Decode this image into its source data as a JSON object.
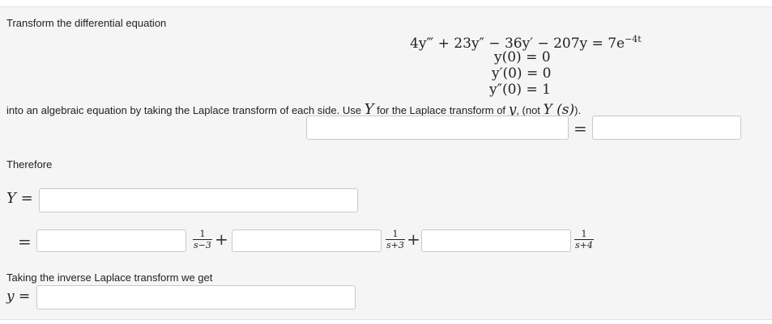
{
  "intro": "Transform the differential equation",
  "equation": {
    "main": "4y‴ + 23y″ − 36y′ − 207y = 7e",
    "main_exp": "−4t",
    "ic1": "y(0) = 0",
    "ic2": "y′(0) = 0",
    "ic3": "y″(0) = 1"
  },
  "instruction": {
    "part1": "into an algebraic equation by taking the Laplace transform of each side. Use",
    "Y1": "Y",
    "part2": "for the Laplace transform of",
    "y": "y",
    "part3": ", (not",
    "Ys": "Y (s)",
    "part4": ")."
  },
  "equals": "=",
  "plus": "+",
  "therefore": "Therefore",
  "Y_label": "Y =",
  "fractions": [
    {
      "num": "1",
      "den": "s−3"
    },
    {
      "num": "1",
      "den": "s+3"
    },
    {
      "num": "1",
      "den": "s+4"
    }
  ],
  "inverse_text": "Taking the inverse Laplace transform we get",
  "y_label": "y ="
}
